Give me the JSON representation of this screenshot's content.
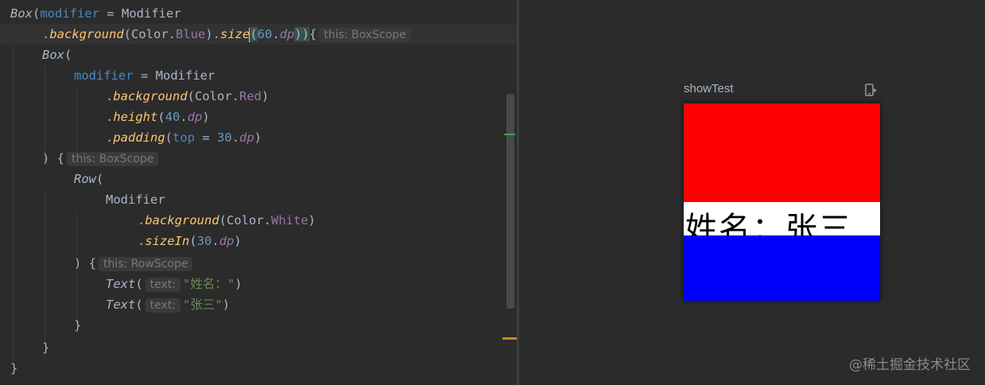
{
  "editor": {
    "l1": {
      "a": "Box",
      "b": "(",
      "c": "modifier",
      "d": " = ",
      "e": "Modifier"
    },
    "l2": {
      "a": ".",
      "b": "background",
      "c": "(Color.",
      "d": "Blue",
      "e": ").",
      "f": "size",
      "g": "(",
      "h": "60",
      "i": ".",
      "j": "dp",
      "k": "))",
      "l": "{",
      "hint": "this: BoxScope"
    },
    "l3": {
      "a": "Box",
      "b": "("
    },
    "l4": {
      "a": "modifier",
      "b": " = ",
      "c": "Modifier"
    },
    "l5": {
      "a": ".",
      "b": "background",
      "c": "(Color.",
      "d": "Red",
      "e": ")"
    },
    "l6": {
      "a": ".",
      "b": "height",
      "c": "(",
      "d": "40",
      "e": ".",
      "f": "dp",
      "g": ")"
    },
    "l7": {
      "a": ".",
      "b": "padding",
      "c": "(",
      "d": "top",
      "e": " = ",
      "f": "30",
      "g": ".",
      "h": "dp",
      "i": ")"
    },
    "l8": {
      "a": ") {",
      "hint": "this: BoxScope"
    },
    "l9": {
      "a": "Row",
      "b": "("
    },
    "l10": {
      "a": "Modifier"
    },
    "l11": {
      "a": ".",
      "b": "background",
      "c": "(Color.",
      "d": "White",
      "e": ")"
    },
    "l12": {
      "a": ".",
      "b": "sizeIn",
      "c": "(",
      "d": "30",
      "e": ".",
      "f": "dp",
      "g": ")"
    },
    "l13": {
      "a": ") {",
      "hint": "this: RowScope"
    },
    "l14": {
      "a": "Text",
      "b": "(",
      "hint": "text:",
      "s": "\"姓名：\"",
      "c": ")"
    },
    "l15": {
      "a": "Text",
      "b": "(",
      "hint": "text:",
      "s": "\"张三\"",
      "c": ")"
    },
    "l16": {
      "a": "}"
    },
    "l17": {
      "a": "}"
    },
    "l18": {
      "a": "}"
    }
  },
  "preview": {
    "title": "showTest",
    "rendered_text": "姓名：张三",
    "colors": {
      "red": "#ff0000",
      "white": "#ffffff",
      "blue": "#0000ff"
    }
  },
  "watermark": "@稀土掘金技术社区",
  "icons": {
    "device": "device-preview-icon"
  }
}
